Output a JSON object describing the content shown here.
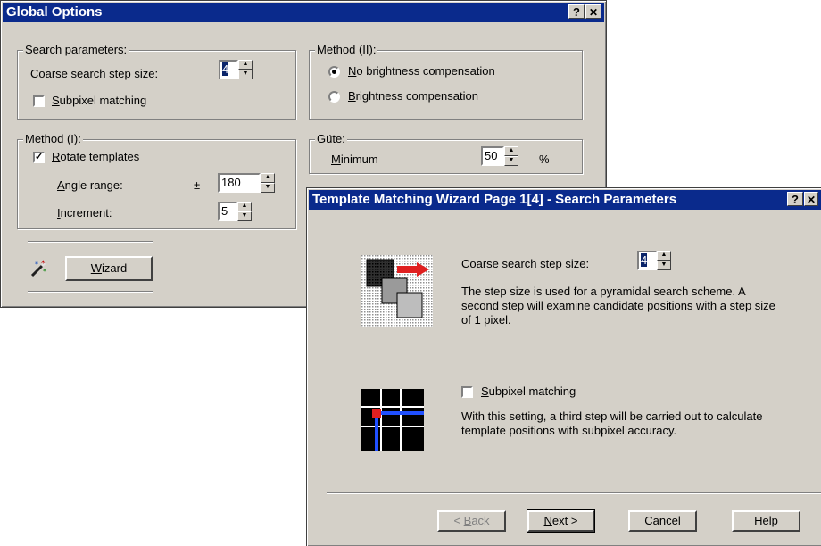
{
  "global_options": {
    "title": "Global Options",
    "help_btn": "?",
    "close_btn": "✕",
    "search_params": {
      "label": "Search parameters:",
      "coarse_label": "Coarse search step size:",
      "coarse_value": "4",
      "subpixel_label": "Subpixel matching",
      "subpixel_checked": false
    },
    "method2": {
      "label": "Method (II):",
      "option_none": "No brightness compensation",
      "option_comp": "Brightness compensation",
      "selected": "none"
    },
    "method1": {
      "label": "Method (I):",
      "rotate_label": "Rotate templates",
      "rotate_mark": "✓",
      "angle_label": "Angle range:",
      "pm": "±",
      "angle_value": "180",
      "increment_label": "Increment:",
      "increment_value": "5"
    },
    "guete": {
      "label": "Güte:",
      "minimum_label": "Minimum",
      "minimum_value": "50",
      "unit": "%"
    },
    "wizard_button": "Wizard",
    "wizard_icon": "magic-wand-icon"
  },
  "wizard": {
    "title": "Template Matching Wizard Page 1[4] - Search Parameters",
    "help_btn": "?",
    "close_btn": "✕",
    "coarse_label": "Coarse search step size:",
    "coarse_value": "4",
    "coarse_desc": "The step size is used for a pyramidal search scheme. A second step will examine candidate positions with a step size of 1 pixel.",
    "subpixel_label": "Subpixel matching",
    "subpixel_desc": "With this setting, a third step will be carried out to calculate template positions with subpixel accuracy.",
    "buttons": {
      "back": "< Back",
      "next": "Next >",
      "cancel": "Cancel",
      "help": "Help"
    }
  }
}
